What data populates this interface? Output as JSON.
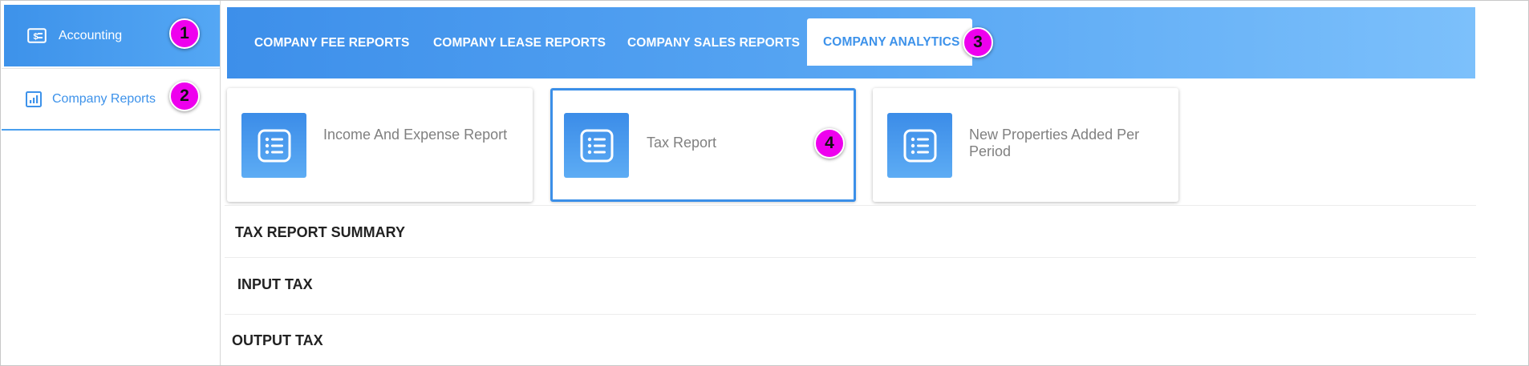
{
  "sidebar": {
    "accounting": {
      "label": "Accounting",
      "icon": "money-icon",
      "badge": "1"
    },
    "company_reports": {
      "label": "Company Reports",
      "icon": "bar-chart-icon",
      "badge": "2"
    }
  },
  "tabs": [
    {
      "label": "COMPANY FEE REPORTS"
    },
    {
      "label": "COMPANY LEASE REPORTS"
    },
    {
      "label": "COMPANY SALES REPORTS"
    },
    {
      "label": "COMPANY ANALYTICS",
      "active": true,
      "badge": "3"
    }
  ],
  "cards": [
    {
      "label": "Income And Expense Report",
      "icon": "list-icon"
    },
    {
      "label": "Tax Report",
      "icon": "list-icon",
      "selected": true,
      "badge": "4"
    },
    {
      "label": "New Properties Added Per Period",
      "icon": "list-icon"
    }
  ],
  "sections": [
    {
      "label": "TAX REPORT SUMMARY"
    },
    {
      "label": "INPUT TAX"
    },
    {
      "label": "OUTPUT TAX"
    }
  ],
  "colors": {
    "accent": "#3d92ea",
    "badge": "#ee00ee"
  }
}
